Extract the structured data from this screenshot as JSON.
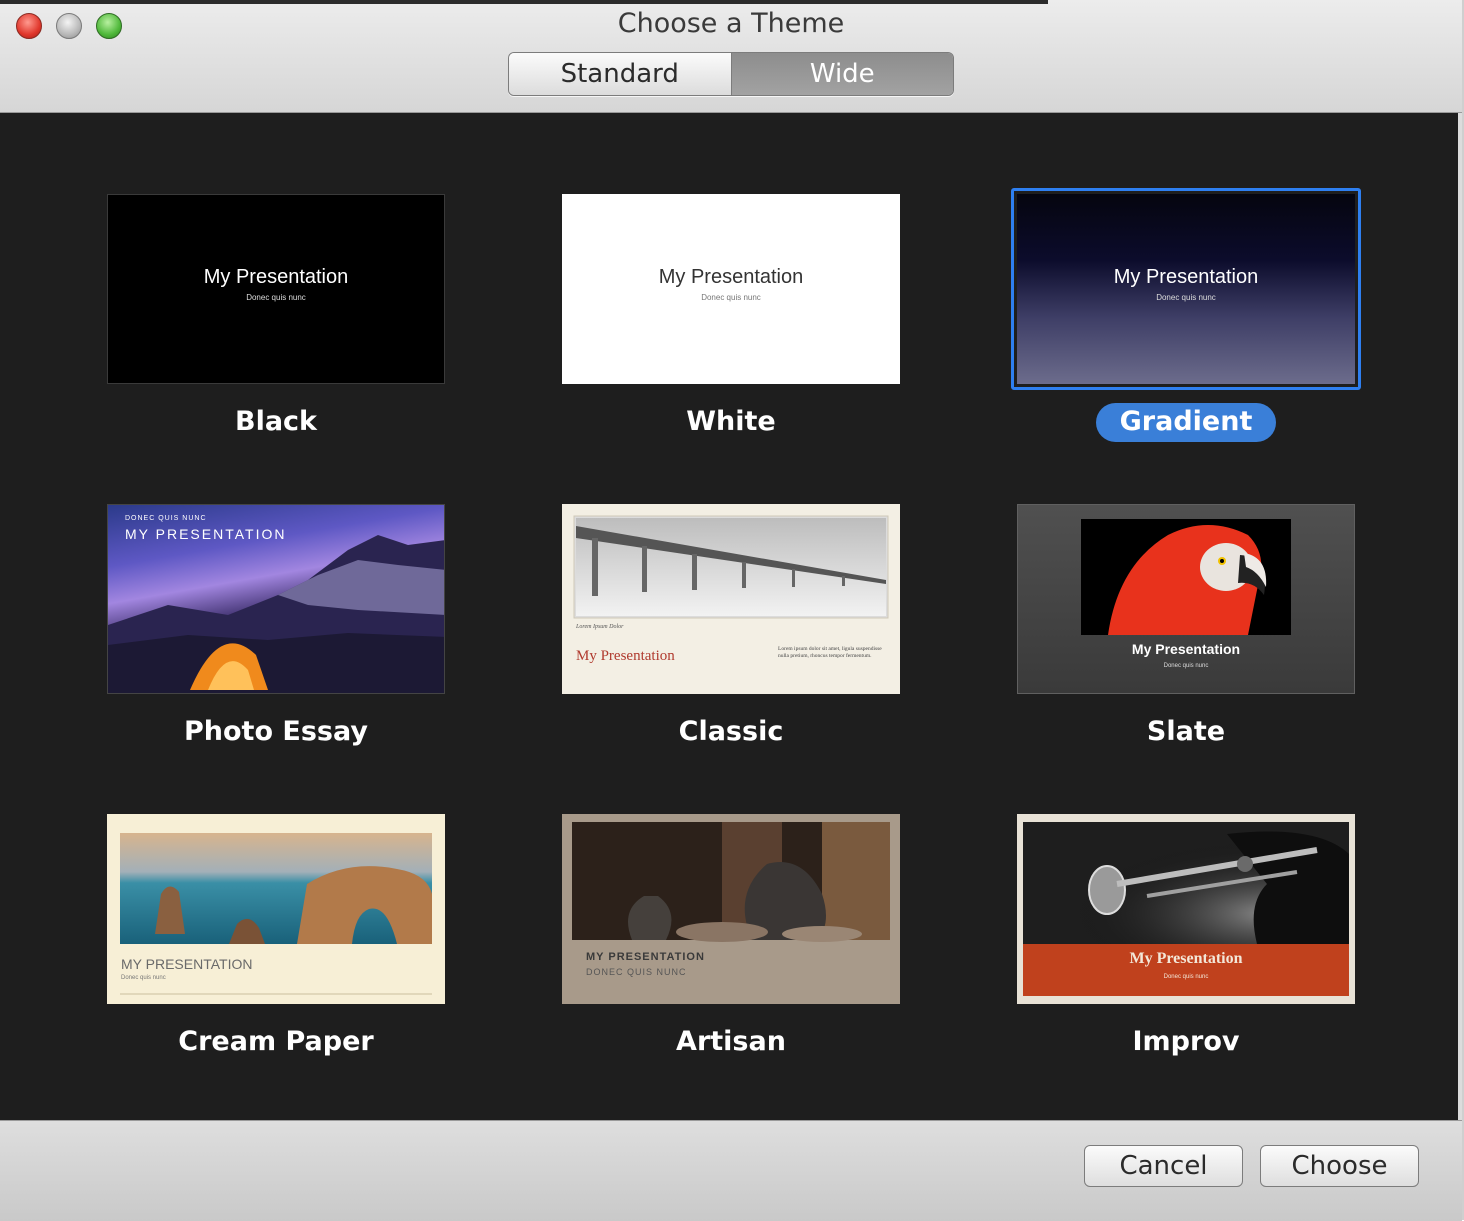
{
  "window": {
    "title": "Choose a Theme"
  },
  "segment": {
    "standard": "Standard",
    "wide": "Wide"
  },
  "sample": {
    "title": "My Presentation",
    "subtitle": "Donec quis nunc"
  },
  "themes": [
    {
      "name": "Black"
    },
    {
      "name": "White"
    },
    {
      "name": "Gradient",
      "selected": true
    },
    {
      "name": "Photo Essay",
      "kicker": "DONEC QUIS NUNC",
      "title": "MY PRESENTATION"
    },
    {
      "name": "Classic",
      "caption": "Lorem Ipsum Dolor",
      "title": "My Presentation",
      "body": "Lorem ipsum dolor sit amet, ligula suspendisse nulla pretium, rhoncus tempor fermentum."
    },
    {
      "name": "Slate",
      "title": "My Presentation",
      "subtitle": "Donec quis nunc"
    },
    {
      "name": "Cream Paper",
      "title": "MY PRESENTATION",
      "subtitle": "Donec quis nunc"
    },
    {
      "name": "Artisan",
      "title": "MY PRESENTATION",
      "subtitle": "DONEC QUIS NUNC"
    },
    {
      "name": "Improv",
      "title": "My Presentation",
      "subtitle": "Donec quis nunc"
    }
  ],
  "buttons": {
    "cancel": "Cancel",
    "choose": "Choose"
  },
  "colors": {
    "selection": "#2e7ff0",
    "label_selected_bg": "#3a7fd8",
    "content_bg": "#1e1e1e"
  }
}
